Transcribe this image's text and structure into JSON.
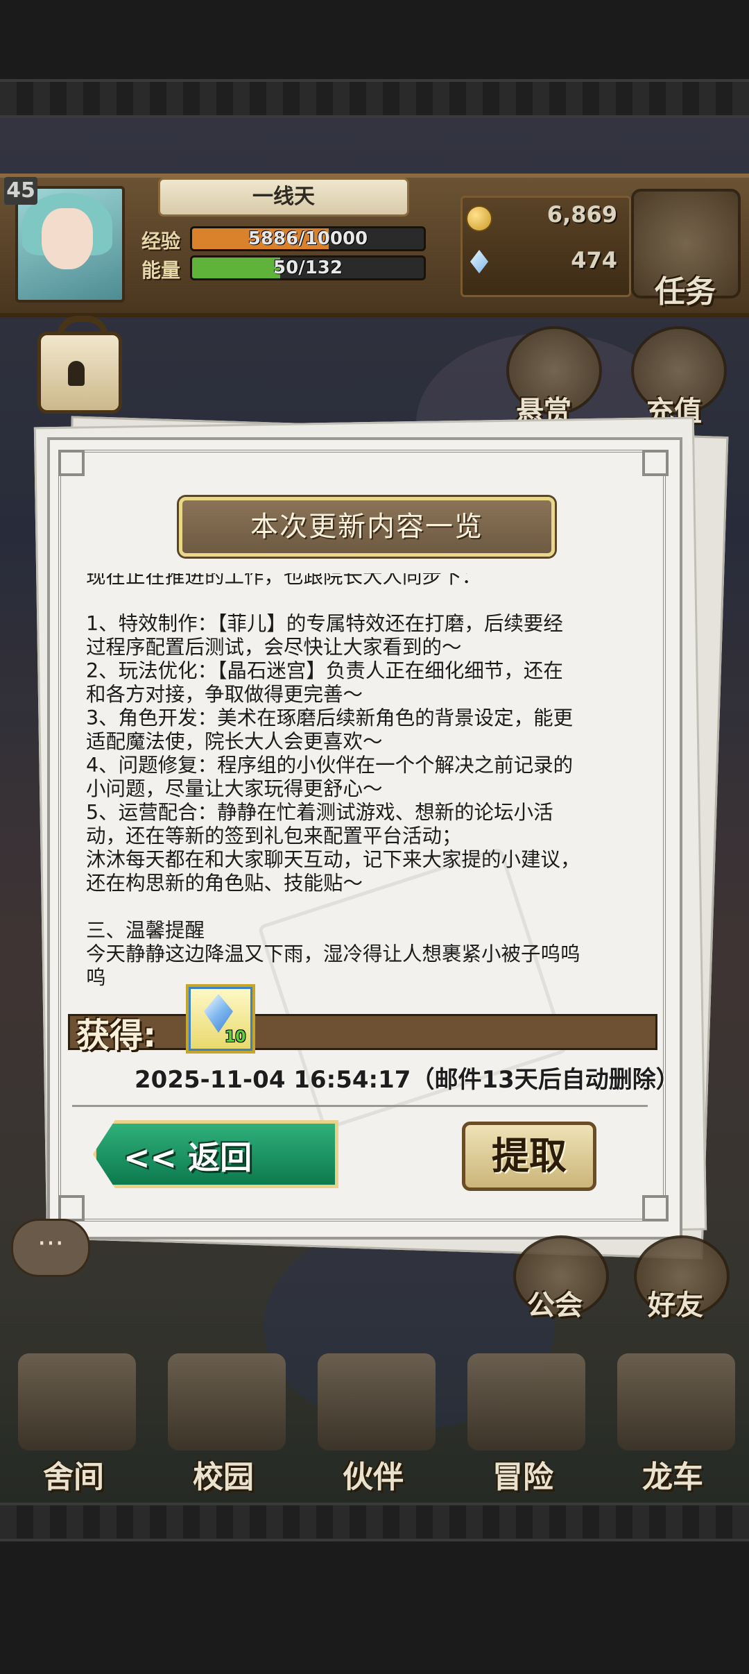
{
  "hud": {
    "level": "45",
    "player_name": "一线天",
    "exp_label": "经验",
    "exp_text": "5886/10000",
    "exp_fraction": 0.5886,
    "energy_label": "能量",
    "energy_text": "50/132",
    "energy_fraction": 0.379,
    "gold": "6,869",
    "gems": "474",
    "quest_label": "任务",
    "bounty_label": "悬赏",
    "recharge_label": "充值"
  },
  "mail": {
    "title": "本次更新内容一览",
    "lines": [
      "现在正在推进的工作，也跟院长大人同步下：",
      "",
      "1、特效制作：【菲儿】的专属特效还在打磨，后续要经",
      "过程序配置后测试，会尽快让大家看到的～",
      "2、玩法优化：【晶石迷宫】负责人正在细化细节，还在",
      "和各方对接，争取做得更完善～",
      "3、角色开发：美术在琢磨后续新角色的背景设定，能更",
      "适配魔法使，院长大人会更喜欢～",
      "4、问题修复：程序组的小伙伴在一个个解决之前记录的",
      "小问题，尽量让大家玩得更舒心～",
      "5、运营配合：静静在忙着测试游戏、想新的论坛小活",
      "动，还在等新的签到礼包来配置平台活动；",
      "沐沐每天都在和大家聊天互动，记下来大家提的小建议，",
      "还在构思新的角色贴、技能贴～",
      "",
      "三、温馨提醒",
      "今天静静这边降温又下雨，湿冷得让人想裹紧小被子呜呜",
      "呜"
    ],
    "reward_label": "获得:",
    "reward_qty": "10",
    "date_text": "2025-11-04 16:54:17（邮件13天后自动删除）",
    "back_label": "<< 返回",
    "claim_label": "提取"
  },
  "side": {
    "guild_label": "公会",
    "friends_label": "好友",
    "chat_icon": "···"
  },
  "nav": [
    {
      "label": "舍间"
    },
    {
      "label": "校园"
    },
    {
      "label": "伙伴"
    },
    {
      "label": "冒险"
    },
    {
      "label": "龙车"
    }
  ],
  "colors": {
    "exp_bar": "#d9822b",
    "energy_bar": "#5fb33a",
    "back_button": "#0f8a58",
    "claim_button": "#e1cf98",
    "reward_bar": "#6e5133"
  }
}
